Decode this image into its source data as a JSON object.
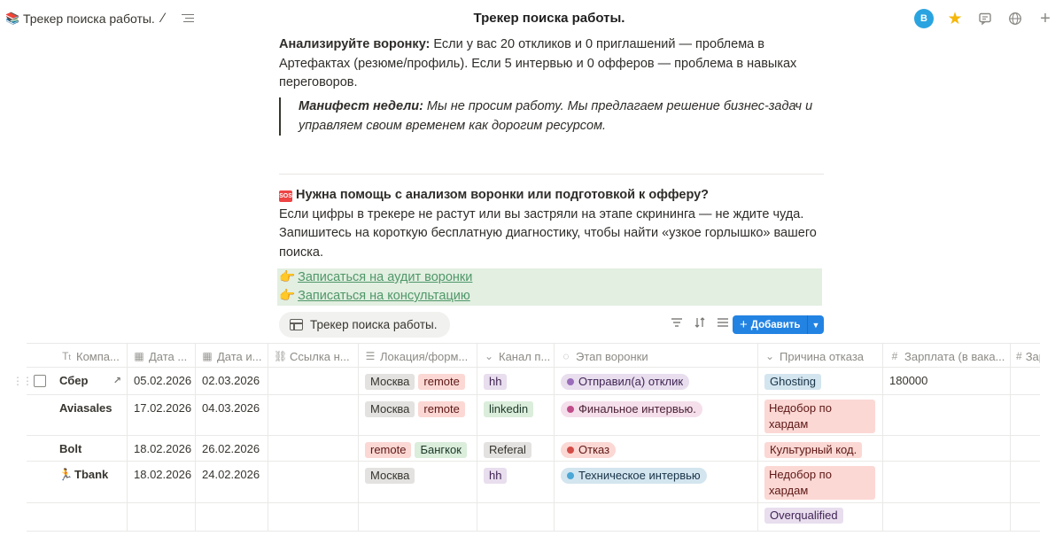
{
  "breadcrumb": {
    "title": "Трекер поиска работы."
  },
  "header": {
    "title": "Трекер поиска работы.",
    "avatar_letter": "B"
  },
  "body": {
    "analyze_bold": "Анализируйте воронку:",
    "analyze_text": " Если у вас 20 откликов и 0 приглашений — проблема в Артефактах (резюме/профиль). Если 5 интервью и 0 офферов — проблема в навыках переговоров.",
    "manifest_bold": "Манифест недели:",
    "manifest_text": " Мы не просим работу. Мы предлагаем решение бизнес-задач и управляем своим временем как дорогим ресурсом.",
    "sos_icon": "SOS",
    "help_title": "Нужна помощь с анализом воронки или подготовкой к офферу?",
    "help_text": "Если цифры в трекере не растут или вы застряли на этапе скрининга — не ждите чуда. Запишитесь на короткую бесплатную диагностику, чтобы найти «узкое горлышко» вашего поиска.",
    "link_audit": "Записаться на аудит воронки",
    "link_consult": "Записаться на консультацию"
  },
  "database": {
    "view_name": "Трекер поиска работы.",
    "add_label": "Добавить",
    "columns": [
      "Компа...",
      "Дата ...",
      "Дата и...",
      "Ссылка н...",
      "Локация/форм...",
      "Канал п...",
      "Этап воронки",
      "Причина отказа",
      "Зарплата (в вака...",
      "Зар"
    ],
    "rows": [
      {
        "company": "Сбер",
        "date1": "05.02.2026",
        "date2": "02.03.2026",
        "location": [
          "Москва",
          "remote"
        ],
        "channel": "hh",
        "stage": "Отправил(а) отклик",
        "reason": "Ghosting",
        "salary": "180000"
      },
      {
        "company": "Aviasales",
        "date1": "17.02.2026",
        "date2": "04.03.2026",
        "location": [
          "Москва",
          "remote"
        ],
        "channel": "linkedin",
        "stage": "Финальное интервью.",
        "reason": "Недобор по хардам",
        "salary": ""
      },
      {
        "company": "Bolt",
        "date1": "18.02.2026",
        "date2": "26.02.2026",
        "location": [
          "remote",
          "Бангкок"
        ],
        "channel": "Referal",
        "stage": "Отказ",
        "reason": "Культурный код.",
        "salary": ""
      },
      {
        "company": "Tbank",
        "date1": "18.02.2026",
        "date2": "24.02.2026",
        "location": [
          "Москва"
        ],
        "channel": "hh",
        "stage": "Техническое интервью",
        "reason": "Недобор по хардам",
        "salary": ""
      },
      {
        "company": "",
        "date1": "",
        "date2": "",
        "location": [],
        "channel": "",
        "stage": "",
        "reason": "Overqualified",
        "salary": ""
      }
    ]
  },
  "colors": {
    "accent": "#2383e2",
    "link": "#4f9768",
    "link_bg": "#e2efe1"
  }
}
